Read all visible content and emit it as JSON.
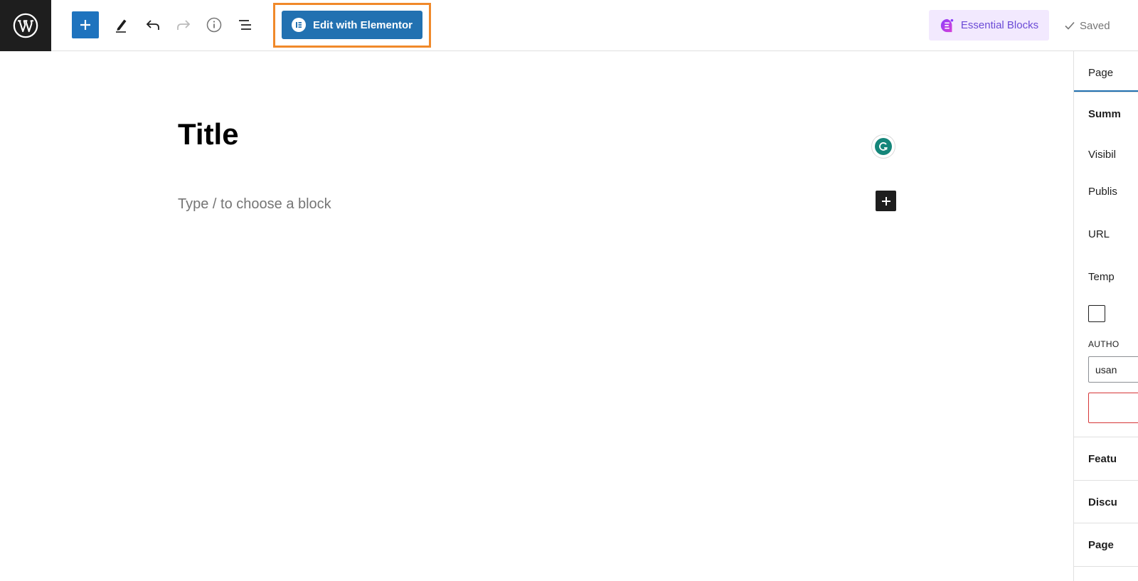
{
  "toolbar": {
    "edit_with_elementor_label": "Edit with Elementor",
    "essential_blocks_label": "Essential Blocks",
    "saved_label": "Saved"
  },
  "editor": {
    "title": "Title",
    "placeholder": "Type / to choose a block"
  },
  "sidebar": {
    "tab_label": "Page",
    "summary_label": "Summ",
    "visibility_label": "Visibil",
    "publish_label": "Publis",
    "url_label": "URL",
    "template_label": "Temp",
    "author_label": "AUTHO",
    "author_value": "usan",
    "featured_label": "Featu",
    "discussion_label": "Discu",
    "page_attributes_label": "Page"
  },
  "colors": {
    "accent_blue": "#2271b1",
    "highlight_orange": "#f0892a",
    "essential_bg": "#f2e9fe",
    "essential_text": "#6b4bd6",
    "grammarly_green": "#15867a"
  },
  "icons": [
    "wordpress-logo-icon",
    "plus-icon",
    "pencil-icon",
    "undo-icon",
    "redo-icon",
    "info-icon",
    "list-view-icon",
    "elementor-icon",
    "essential-blocks-icon",
    "check-icon",
    "grammarly-icon"
  ]
}
